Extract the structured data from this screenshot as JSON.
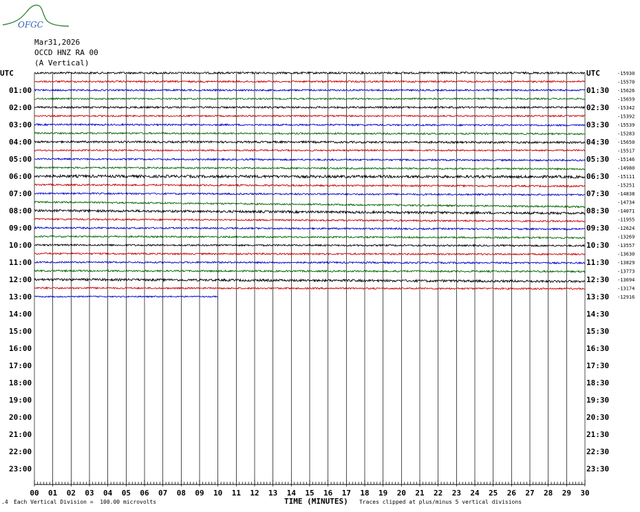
{
  "header": {
    "logo_text": "OFGC",
    "date": "Mar31,2026",
    "station": "OCCD HNZ RA 00",
    "component": "(A Vertical)"
  },
  "chart_data": {
    "type": "line",
    "title": "",
    "xlabel": "TIME (MINUTES)",
    "ylabel": "",
    "x_ticks": [
      "00",
      "01",
      "02",
      "03",
      "04",
      "05",
      "06",
      "07",
      "08",
      "09",
      "10",
      "11",
      "12",
      "13",
      "14",
      "15",
      "16",
      "17",
      "18",
      "19",
      "20",
      "21",
      "22",
      "23",
      "24",
      "25",
      "26",
      "27",
      "28",
      "29",
      "30"
    ],
    "xlim": [
      0,
      30
    ],
    "left_labels": [
      "UTC",
      "01:00",
      "02:00",
      "03:00",
      "04:00",
      "05:00",
      "06:00",
      "07:00",
      "08:00",
      "09:00",
      "10:00",
      "11:00",
      "12:00",
      "13:00",
      "14:00",
      "15:00",
      "16:00",
      "17:00",
      "18:00",
      "19:00",
      "20:00",
      "21:00",
      "22:00",
      "23:00"
    ],
    "right_labels": [
      "UTC",
      "01:30",
      "02:30",
      "03:30",
      "04:30",
      "05:30",
      "06:30",
      "07:30",
      "08:30",
      "09:30",
      "10:30",
      "11:30",
      "12:30",
      "13:30",
      "14:30",
      "15:30",
      "16:30",
      "17:30",
      "18:30",
      "19:30",
      "20:30",
      "21:30",
      "22:30",
      "23:30"
    ],
    "trace_offsets": [
      "-15930",
      "-15570",
      "-15626",
      "-15659",
      "-15342",
      "-15392",
      "-15539",
      "-15283",
      "-15650",
      "-15517",
      "-15146",
      "-14980",
      "-15111",
      "-15251",
      "-14838",
      "-14734",
      "-14071",
      "-11955",
      "-12624",
      "-13269",
      "-13557",
      "-13630",
      "-13829",
      "-13773",
      "-13694",
      "-13174",
      "-12916"
    ],
    "trace_colors": [
      "#000000",
      "#cc0000",
      "#0000cc",
      "#006600"
    ],
    "series": [
      {
        "trace": 0,
        "drift": 0,
        "amp": 1.2
      },
      {
        "trace": 1,
        "drift": 0,
        "amp": 1.0
      },
      {
        "trace": 2,
        "drift": 0,
        "amp": 1.0
      },
      {
        "trace": 3,
        "drift": 0,
        "amp": 0.9
      },
      {
        "trace": 4,
        "drift": 0,
        "amp": 1.1
      },
      {
        "trace": 5,
        "drift": 0,
        "amp": 0.9
      },
      {
        "trace": 6,
        "drift": 1,
        "amp": 1.0
      },
      {
        "trace": 7,
        "drift": 1,
        "amp": 1.0
      },
      {
        "trace": 8,
        "drift": 1,
        "amp": 1.2
      },
      {
        "trace": 9,
        "drift": 0,
        "amp": 0.9
      },
      {
        "trace": 10,
        "drift": 2,
        "amp": 1.0
      },
      {
        "trace": 11,
        "drift": 2,
        "amp": 1.0
      },
      {
        "trace": 12,
        "drift": 1,
        "amp": 1.6
      },
      {
        "trace": 13,
        "drift": 2,
        "amp": 1.0
      },
      {
        "trace": 14,
        "drift": 2,
        "amp": 1.0
      },
      {
        "trace": 15,
        "drift": 7,
        "amp": 1.0
      },
      {
        "trace": 16,
        "drift": 4,
        "amp": 1.4
      },
      {
        "trace": 17,
        "drift": 3,
        "amp": 1.0
      },
      {
        "trace": 18,
        "drift": 2,
        "amp": 1.0
      },
      {
        "trace": 19,
        "drift": 2,
        "amp": 1.0
      },
      {
        "trace": 20,
        "drift": 1,
        "amp": 1.0
      },
      {
        "trace": 21,
        "drift": 1,
        "amp": 1.0
      },
      {
        "trace": 22,
        "drift": 1,
        "amp": 1.0
      },
      {
        "trace": 23,
        "drift": 1,
        "amp": 1.0
      },
      {
        "trace": 24,
        "drift": 3,
        "amp": 1.4
      },
      {
        "trace": 25,
        "drift": 1,
        "amp": 1.0
      },
      {
        "trace": 26,
        "drift": 0,
        "amp": 0.8,
        "end_minute": 10
      }
    ],
    "grid": true
  },
  "footer": {
    "scale_note": "Each Vertical Division =  100.00 microvolts",
    "time_label": "TIME (MINUTES)",
    "clip_note": "Traces clipped at plus/minus 5 vertical divisions"
  }
}
